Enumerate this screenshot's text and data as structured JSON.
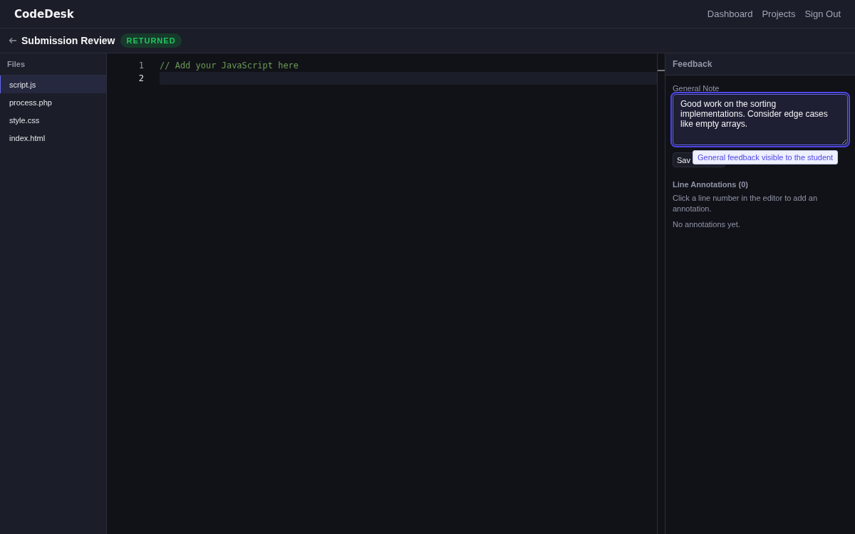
{
  "app": {
    "logo": "CodeDesk",
    "nav": [
      "Dashboard",
      "Projects",
      "Sign Out"
    ]
  },
  "page": {
    "title": "Submission Review",
    "status": "RETURNED"
  },
  "files": {
    "heading": "Files",
    "items": [
      {
        "name": "script.js",
        "selected": true
      },
      {
        "name": "process.php",
        "selected": false
      },
      {
        "name": "style.css",
        "selected": false
      },
      {
        "name": "index.html",
        "selected": false
      }
    ]
  },
  "editor": {
    "lines": [
      {
        "number": "1",
        "text": "// Add your JavaScript here",
        "current": false
      },
      {
        "number": "2",
        "current": true
      }
    ]
  },
  "feedback": {
    "heading": "Feedback",
    "note_label": "General Note",
    "note_value": "Good work on the sorting implementations. Consider edge cases like empty arrays.",
    "save_button": "Sav",
    "tooltip": "General feedback visible to the student",
    "annotations_heading": "Line Annotations (0)",
    "annotations_hint": "Click a line number in the editor to add an annotation.",
    "annotations_empty": "No annotations yet."
  }
}
